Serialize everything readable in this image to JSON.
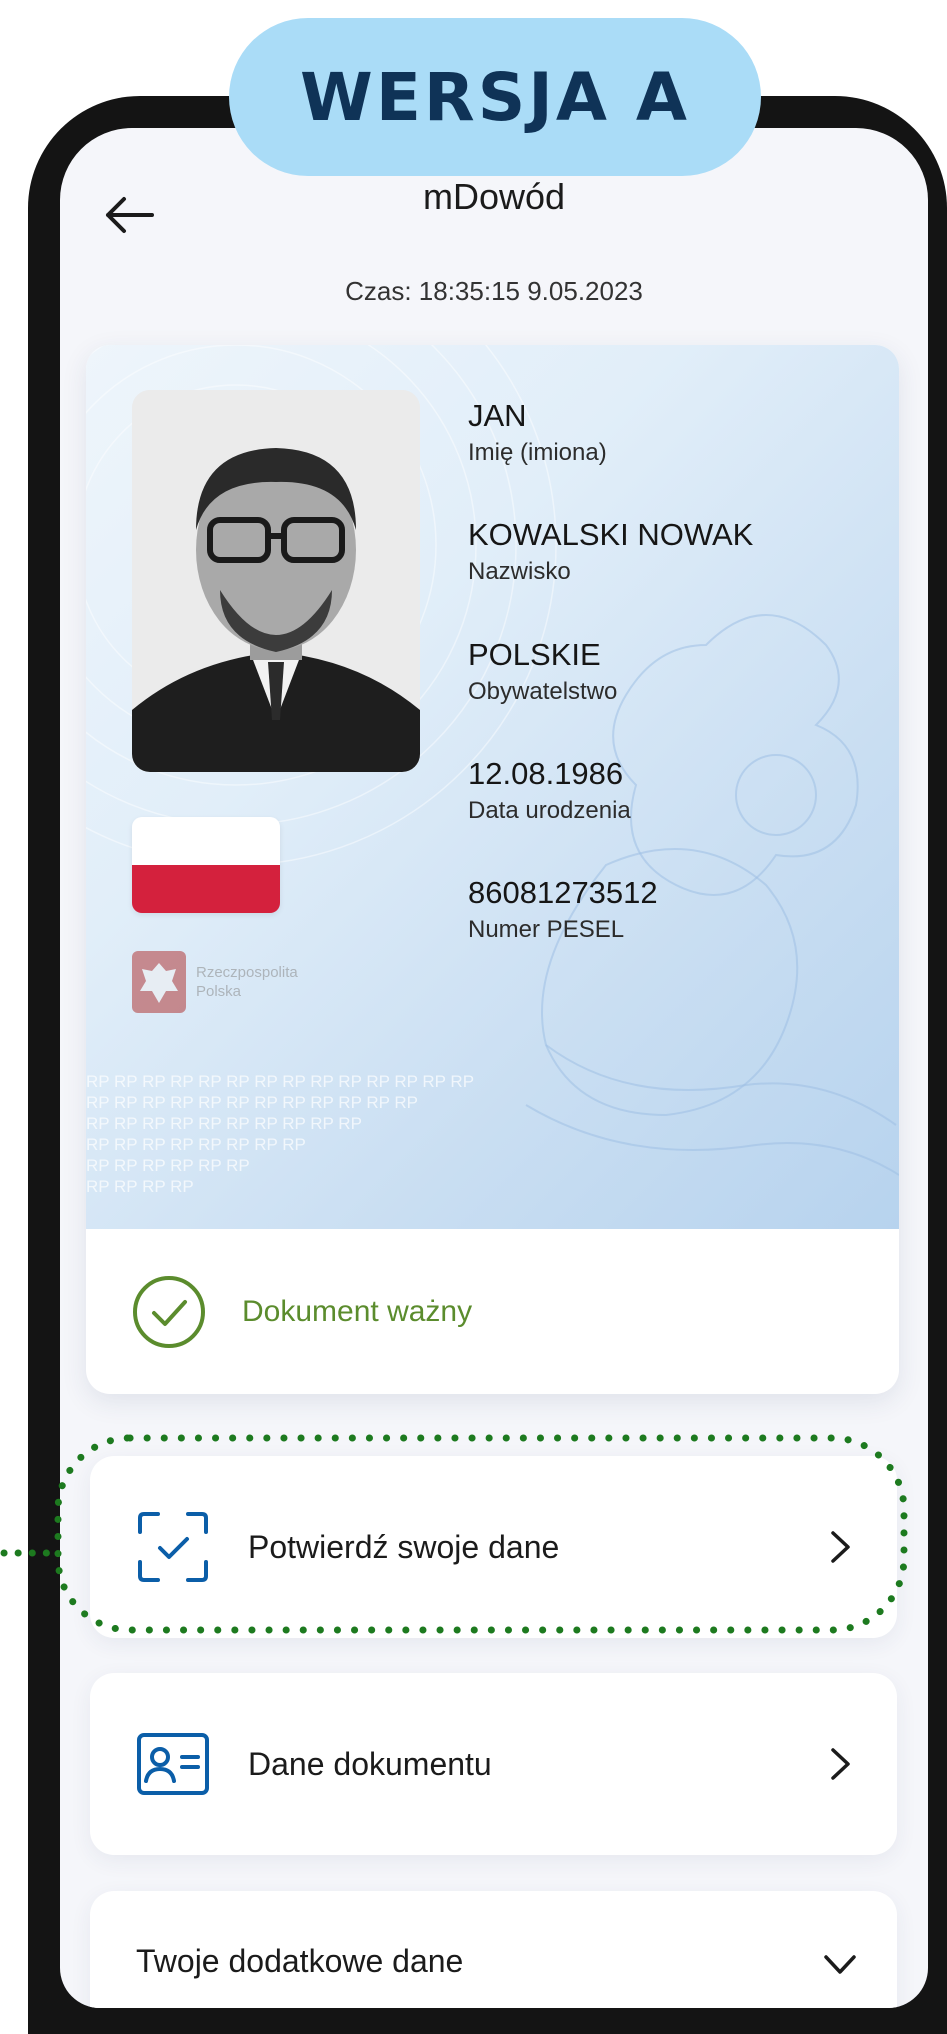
{
  "version_label": "WERSJA A",
  "header": {
    "title": "mDowód"
  },
  "timestamp": "Czas: 18:35:15 9.05.2023",
  "card": {
    "fields": [
      {
        "value": "JAN",
        "label": "Imię (imiona)"
      },
      {
        "value": "KOWALSKI NOWAK",
        "label": "Nazwisko"
      },
      {
        "value": "POLSKIE",
        "label": "Obywatelstwo"
      },
      {
        "value": "12.08.1986",
        "label": "Data urodzenia"
      },
      {
        "value": "86081273512",
        "label": "Numer PESEL"
      }
    ],
    "emblem_text_1": "Rzeczpospolita",
    "emblem_text_2": "Polska",
    "watermark_text": "RP",
    "status": "Dokument ważny"
  },
  "actions": {
    "confirm_label": "Potwierdź swoje dane",
    "document_label": "Dane dokumentu",
    "additional_label": "Twoje dodatkowe dane"
  },
  "colors": {
    "pill": "#aadcf7",
    "pill_text": "#0f3357",
    "accent_blue": "#0b5ea8",
    "status_green": "#5b8c2d",
    "highlight_green": "#1d7a1f",
    "flag_red": "#d4213d"
  },
  "icons": {
    "back": "arrow-left-icon",
    "status": "check-circle-icon",
    "confirm": "scan-check-icon",
    "document": "id-card-icon",
    "chevron_right": "chevron-right-icon",
    "chevron_down": "chevron-down-icon"
  }
}
